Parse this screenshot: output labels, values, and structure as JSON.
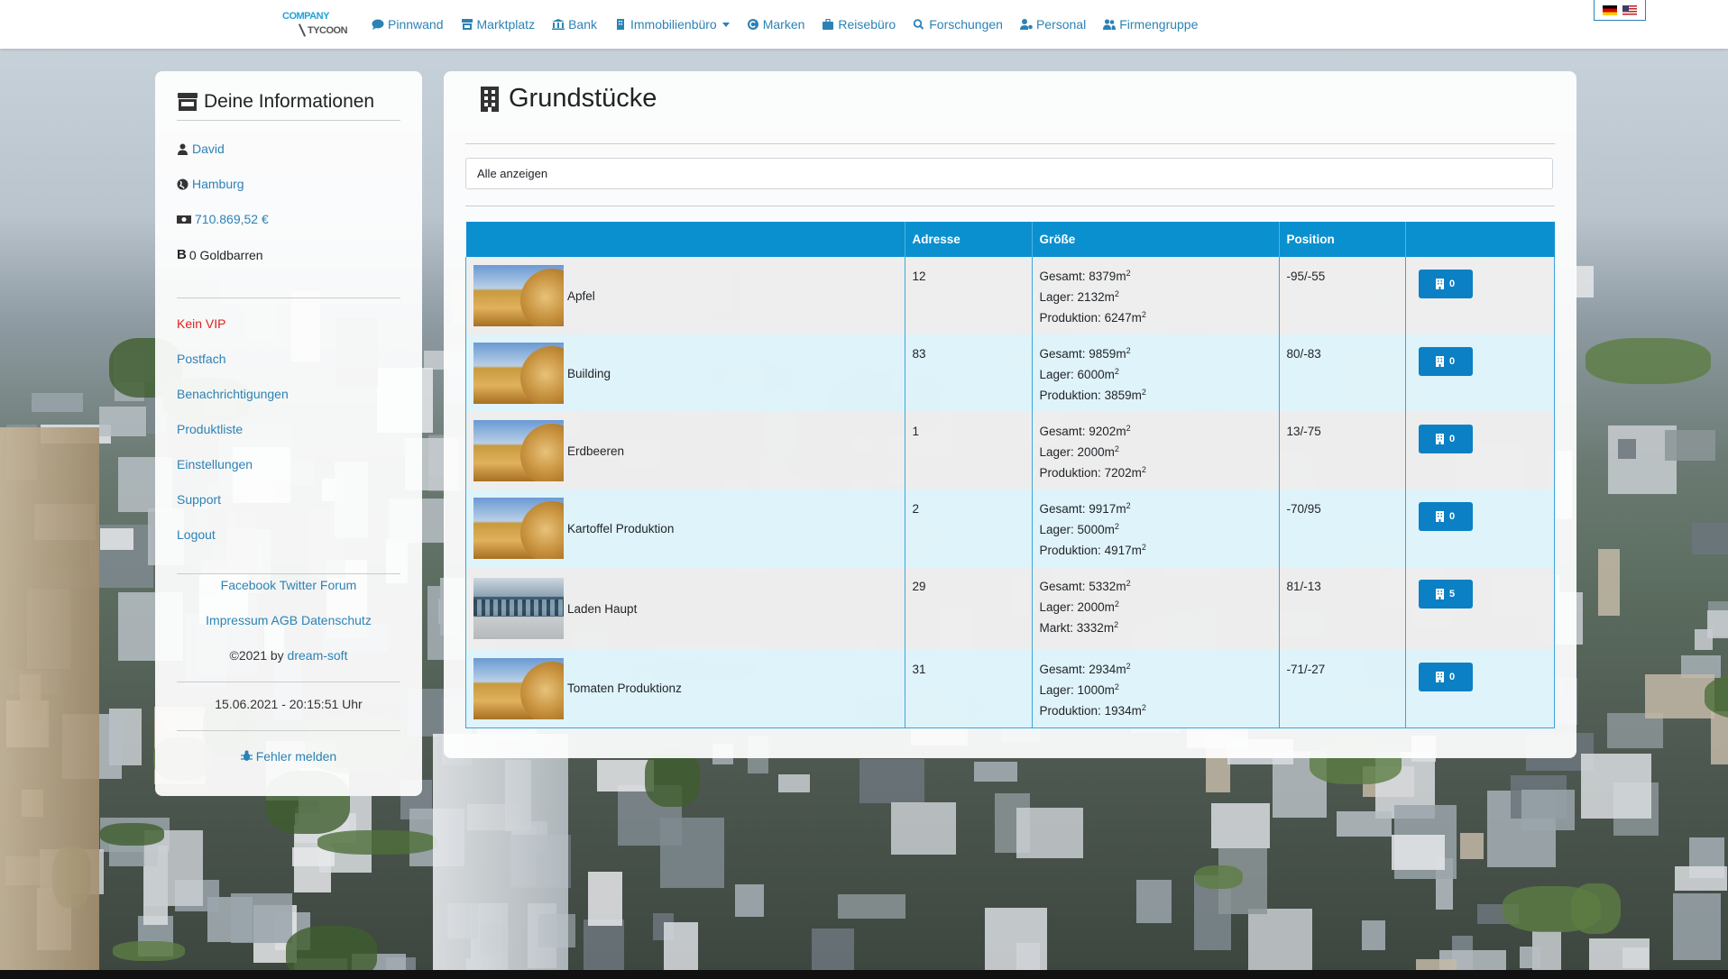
{
  "nav": {
    "logo_top": "COMPANY",
    "logo_bottom": "TYCOON",
    "items": [
      {
        "label": "Pinnwand",
        "icon": "comment-icon"
      },
      {
        "label": "Marktplatz",
        "icon": "store-icon"
      },
      {
        "label": "Bank",
        "icon": "bank-icon"
      },
      {
        "label": "Immobilienbüro",
        "icon": "building-icon",
        "dropdown": true
      },
      {
        "label": "Marken",
        "icon": "copyright-icon"
      },
      {
        "label": "Reisebüro",
        "icon": "suitcase-icon"
      },
      {
        "label": "Forschungen",
        "icon": "search-icon"
      },
      {
        "label": "Personal",
        "icon": "user-cog-icon"
      },
      {
        "label": "Firmengruppe",
        "icon": "users-icon"
      }
    ],
    "languages": [
      "de",
      "us"
    ]
  },
  "sidebar": {
    "title": "Deine Informationen",
    "user": "David",
    "city": "Hamburg",
    "money": "710.869,52 €",
    "gold": "0 Goldbarren",
    "vip": "Kein VIP",
    "links": [
      "Postfach",
      "Benachrichtigungen",
      "Produktliste",
      "Einstellungen",
      "Support",
      "Logout"
    ],
    "social": [
      "Facebook",
      "Twitter",
      "Forum"
    ],
    "legal": [
      "Impressum",
      "AGB",
      "Datenschutz"
    ],
    "copyright_prefix": "©2021 by",
    "copyright_link": "dream-soft",
    "datetime": "15.06.2021 - 20:15:51 Uhr",
    "report": "Fehler melden"
  },
  "main": {
    "title": "Grundstücke",
    "filter_value": "Alle anzeigen",
    "columns": [
      "",
      "Adresse",
      "Größe",
      "Position",
      ""
    ],
    "rows": [
      {
        "name": "Apfel",
        "thumb": "field",
        "address": "12",
        "sizes": [
          {
            "label": "Gesamt:",
            "value": "8379m"
          },
          {
            "label": "Lager:",
            "value": "2132m"
          },
          {
            "label": "Produktion:",
            "value": "6247m"
          }
        ],
        "position": "-95/-55",
        "count": "0"
      },
      {
        "name": "Building",
        "thumb": "field",
        "address": "83",
        "sizes": [
          {
            "label": "Gesamt:",
            "value": "9859m"
          },
          {
            "label": "Lager:",
            "value": "6000m"
          },
          {
            "label": "Produktion:",
            "value": "3859m"
          }
        ],
        "position": "80/-83",
        "count": "0"
      },
      {
        "name": "Erdbeeren",
        "thumb": "field",
        "address": "1",
        "sizes": [
          {
            "label": "Gesamt:",
            "value": "9202m"
          },
          {
            "label": "Lager:",
            "value": "2000m"
          },
          {
            "label": "Produktion:",
            "value": "7202m"
          }
        ],
        "position": "13/-75",
        "count": "0"
      },
      {
        "name": "Kartoffel Produktion",
        "thumb": "field",
        "address": "2",
        "sizes": [
          {
            "label": "Gesamt:",
            "value": "9917m"
          },
          {
            "label": "Lager:",
            "value": "5000m"
          },
          {
            "label": "Produktion:",
            "value": "4917m"
          }
        ],
        "position": "-70/95",
        "count": "0"
      },
      {
        "name": "Laden Haupt",
        "thumb": "shop",
        "address": "29",
        "sizes": [
          {
            "label": "Gesamt:",
            "value": "5332m"
          },
          {
            "label": "Lager:",
            "value": "2000m"
          },
          {
            "label": "Markt:",
            "value": "3332m"
          }
        ],
        "position": "81/-13",
        "count": "5"
      },
      {
        "name": "Tomaten Produktionz",
        "thumb": "field",
        "address": "31",
        "sizes": [
          {
            "label": "Gesamt:",
            "value": "2934m"
          },
          {
            "label": "Lager:",
            "value": "1000m"
          },
          {
            "label": "Produktion:",
            "value": "1934m"
          }
        ],
        "position": "-71/-27",
        "count": "0"
      }
    ],
    "unit_exponent": "2"
  }
}
